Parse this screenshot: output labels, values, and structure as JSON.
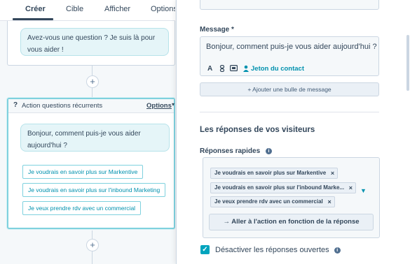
{
  "tabs": [
    {
      "label": "Créer"
    },
    {
      "label": "Cible"
    },
    {
      "label": "Afficher"
    },
    {
      "label": "Options"
    }
  ],
  "flow": {
    "card1_message": "Avez-vous une question ? Je suis là pour vous aider !",
    "card2": {
      "title": "Action questions récurrents",
      "options_label": "Options",
      "bubble_text": "Bonjour, comment puis-je vous aider aujourd'hui ?",
      "quick_replies": [
        {
          "label": "Je voudrais en savoir plus sur Markentive"
        },
        {
          "label": "Je voudrais en savoir plus sur l'inbound Marketing"
        },
        {
          "label": "Je veux prendre rdv avec un commercial"
        }
      ]
    },
    "add_symbol": "+"
  },
  "panel": {
    "message_label": "Message *",
    "message_text": "Bonjour, comment puis-je vous aider aujourd'hui ?",
    "toolbar": {
      "text_format": "A",
      "token_label": "Jeton du contact"
    },
    "add_bubble_label": "+ Ajouter une bulle de message",
    "responses_title": "Les réponses de vos visiteurs",
    "quick_replies_label": "Réponses rapides",
    "quick_reply_tags": [
      {
        "label": "Je voudrais en savoir plus sur Markentive"
      },
      {
        "label": "Je voudrais en savoir plus sur l'inbound Marke..."
      },
      {
        "label": "Je veux prendre rdv avec un commercial"
      }
    ],
    "action_button_label": "→ Aller à l'action en fonction de la réponse",
    "disable_open_label": "Désactiver les réponses ouvertes",
    "disable_open_checked": true
  },
  "icons": {
    "question": "question-icon",
    "remove": "close-icon",
    "info": "info-icon",
    "check": "check-icon"
  },
  "colors": {
    "accent": "#0091ae",
    "bubble_bg": "#e5f5f8",
    "selected_border": "#7fd1de",
    "checkbox": "#00a4bd"
  }
}
